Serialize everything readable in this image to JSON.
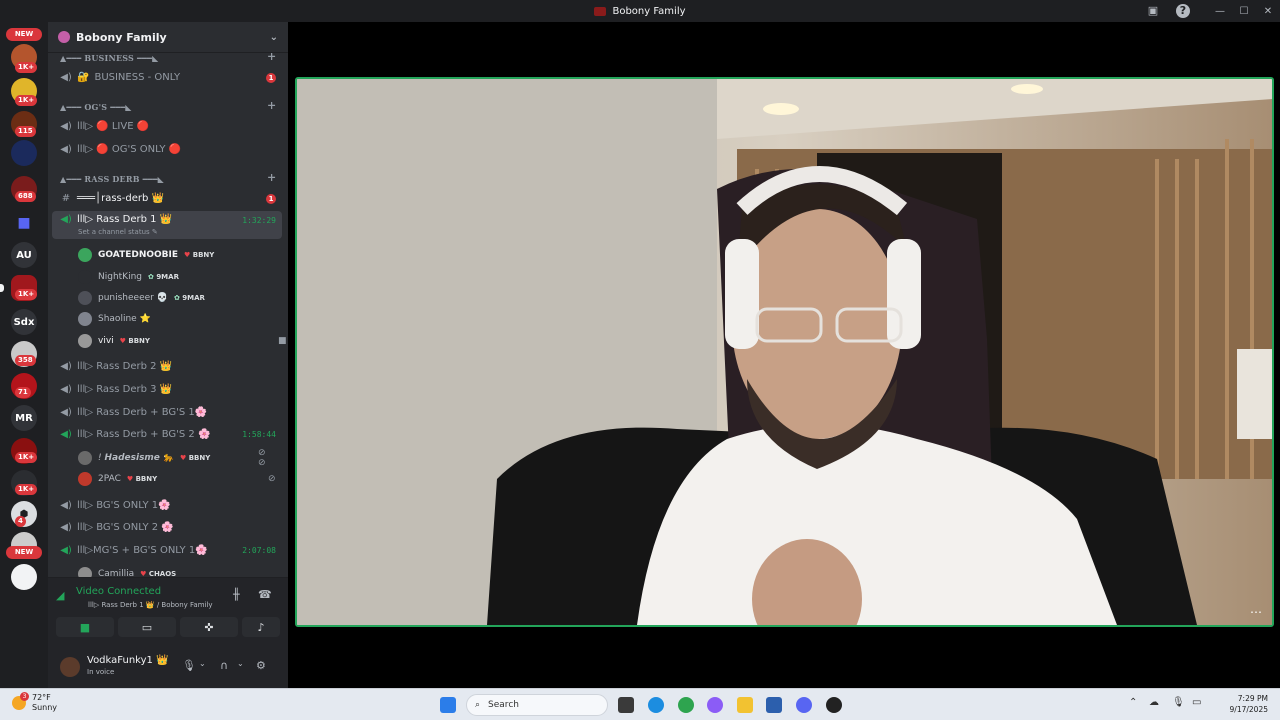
{
  "window": {
    "title": "Bobony Family"
  },
  "rail": {
    "new_label": "NEW",
    "badges": [
      "1K+",
      "1K+",
      "115",
      "688",
      "1K+",
      "358",
      "71",
      "1K+",
      "1K+",
      "4"
    ],
    "text_servers": [
      "AU",
      "Sdx",
      "MR"
    ]
  },
  "server": {
    "name": "Bobony Family"
  },
  "categories": [
    {
      "label": "▲━━━ BUSINESS ━━━◣"
    },
    {
      "label": "▲━━━ OG'S ━━━◣"
    },
    {
      "label": "▲━━━ RASS DERB ━━━◣"
    }
  ],
  "channels": {
    "business_only": {
      "label": "BUSINESS - ONLY",
      "unread": "1"
    },
    "live": {
      "label": "lll▷ 🔴 LIVE 🔴"
    },
    "ogs_only": {
      "label": "lll▷ 🔴 OG'S ONLY 🔴"
    },
    "rass_derb_text": {
      "label": "═══│rass-derb 👑",
      "unread": "1"
    },
    "rass_derb_1": {
      "label": "lll▷ Rass Derb 1 👑",
      "time": "1:32:29",
      "status": "Set a channel status ✎"
    },
    "rass_derb_2": {
      "label": "lll▷ Rass Derb 2 👑"
    },
    "rass_derb_3": {
      "label": "lll▷ Rass Derb 3 👑"
    },
    "rass_bg1": {
      "label": "lll▷ Rass Derb + BG'S 1🌸"
    },
    "rass_bg2": {
      "label": "lll▷ Rass Derb + BG'S 2 🌸",
      "time": "1:58:44"
    },
    "bgs_only_1": {
      "label": "lll▷ BG'S ONLY 1🌸"
    },
    "bgs_only_2": {
      "label": "lll▷ BG'S ONLY 2 🌸"
    },
    "mgs_bgs_1": {
      "label": "lll▷MG'S + BG'S ONLY 1🌸",
      "time": "2:07:08"
    }
  },
  "voice_users": [
    {
      "name": "GOATEDNOOBIE",
      "tag": "BBNY"
    },
    {
      "name": "NightKing",
      "tag": "9MAR"
    },
    {
      "name": "punisheeeer 💀",
      "tag": "9MAR"
    },
    {
      "name": "Shaoline ⭐",
      "tag": ""
    },
    {
      "name": "vivi",
      "tag": "BBNY"
    },
    {
      "name": "! 𝙃𝙖𝙙𝙚𝙨𝙞𝙨𝙢𝙚 🐆",
      "tag": "BBNY"
    },
    {
      "name": "2PAC",
      "tag": "BBNY"
    },
    {
      "name": "Camillia",
      "tag": "CHAOS"
    }
  ],
  "voice_panel": {
    "status": "Video Connected",
    "location": "lll▷ Rass Derb 1 👑 / Bobony Family"
  },
  "user_panel": {
    "name": "VodkaFunky1 👑",
    "status": "In voice"
  },
  "taskbar": {
    "temp": "72°F",
    "condition": "Sunny",
    "weather_badge": "3",
    "search_placeholder": "Search",
    "time": "7:29 PM",
    "date": "9/17/2025"
  },
  "colors": {
    "accent_green": "#23a55a",
    "sidebar": "#2b2d31",
    "rail": "#1e1f22",
    "alert_red": "#da373c"
  }
}
